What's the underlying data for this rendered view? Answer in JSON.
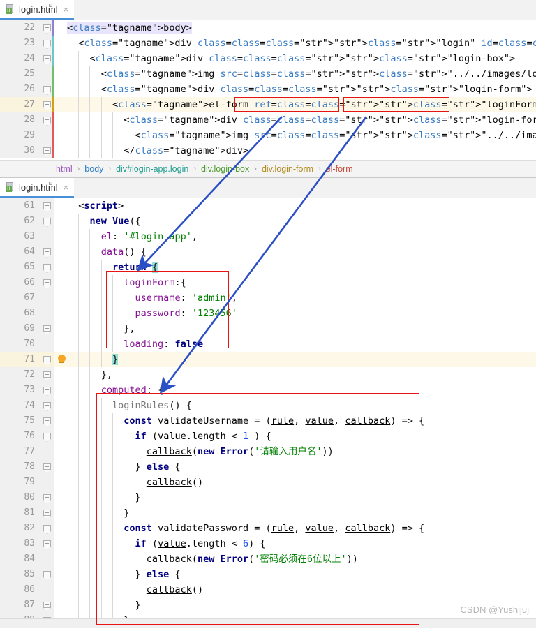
{
  "window": {
    "watermark": "CSDN @Yushijuj"
  },
  "panes": [
    {
      "tab": {
        "label": "login.html",
        "icon": "html-file-icon",
        "badge": "H",
        "close": "×"
      },
      "breadcrumb": [
        "html",
        "body",
        "div#login-app.login",
        "div.login-box",
        "div.login-form",
        "el-form"
      ],
      "lines": [
        {
          "num": "22",
          "text": "<body>"
        },
        {
          "num": "23",
          "text": "  <div class=\"login\" id=\"login-app\">"
        },
        {
          "num": "24",
          "text": "    <div class=\"login-box\">"
        },
        {
          "num": "25",
          "text": "      <img src=\"../../images/login/login-l.png\" alt=\"\">"
        },
        {
          "num": "26",
          "text": "      <div class=\"login-form\">"
        },
        {
          "num": "27",
          "text": "        <el-form ref=\"loginForm\" :model=\"loginForm\" :rules=\"loginRules\" >"
        },
        {
          "num": "28",
          "text": "          <div class=\"login-form-title\">"
        },
        {
          "num": "29",
          "text": "            <img src=\"../../images/login/logo.png\" style=\"...\" alt=\"\" />"
        },
        {
          "num": "30",
          "text": "          </div>"
        }
      ]
    },
    {
      "tab": {
        "label": "login.html",
        "icon": "html-file-icon",
        "badge": "H",
        "close": "×"
      },
      "lines": [
        {
          "num": "61",
          "text": "  <script>"
        },
        {
          "num": "62",
          "text": "    new Vue({"
        },
        {
          "num": "63",
          "text": "      el: '#login-app',"
        },
        {
          "num": "64",
          "text": "      data() {"
        },
        {
          "num": "65",
          "text": "        return {"
        },
        {
          "num": "66",
          "text": "          loginForm:{"
        },
        {
          "num": "67",
          "text": "            username: 'admin',"
        },
        {
          "num": "68",
          "text": "            password: '123456'"
        },
        {
          "num": "69",
          "text": "          },"
        },
        {
          "num": "70",
          "text": "          loading: false"
        },
        {
          "num": "71",
          "text": "        }"
        },
        {
          "num": "72",
          "text": "      },"
        },
        {
          "num": "73",
          "text": "      computed: {"
        },
        {
          "num": "74",
          "text": "        loginRules() {"
        },
        {
          "num": "75",
          "text": "          const validateUsername = (rule, value, callback) => {"
        },
        {
          "num": "76",
          "text": "            if (value.length < 1 ) {"
        },
        {
          "num": "77",
          "text": "              callback(new Error('请输入用户名'))"
        },
        {
          "num": "78",
          "text": "            } else {"
        },
        {
          "num": "79",
          "text": "              callback()"
        },
        {
          "num": "80",
          "text": "            }"
        },
        {
          "num": "81",
          "text": "          }"
        },
        {
          "num": "82",
          "text": "          const validatePassword = (rule, value, callback) => {"
        },
        {
          "num": "83",
          "text": "            if (value.length < 6) {"
        },
        {
          "num": "84",
          "text": "              callback(new Error('密码必须在6位以上'))"
        },
        {
          "num": "85",
          "text": "            } else {"
        },
        {
          "num": "86",
          "text": "              callback()"
        },
        {
          "num": "87",
          "text": "            }"
        },
        {
          "num": "88",
          "text": "          }"
        }
      ]
    }
  ],
  "annotations": {
    "boxes": [
      {
        "name": "model-attr-box",
        "label": ":model=\"loginForm\""
      },
      {
        "name": "rules-attr-box",
        "label": ":rules=\"loginRules\""
      },
      {
        "name": "login-form-data-box",
        "label": "loginForm data object"
      },
      {
        "name": "login-rules-computed-box",
        "label": "loginRules computed"
      }
    ],
    "arrows": [
      {
        "name": "model-to-data-arrow",
        "color": "#2b4fc4"
      },
      {
        "name": "rules-to-computed-arrow",
        "color": "#2b4fc4"
      }
    ],
    "color_red": "#e81313",
    "color_blue": "#2b4fc4"
  }
}
